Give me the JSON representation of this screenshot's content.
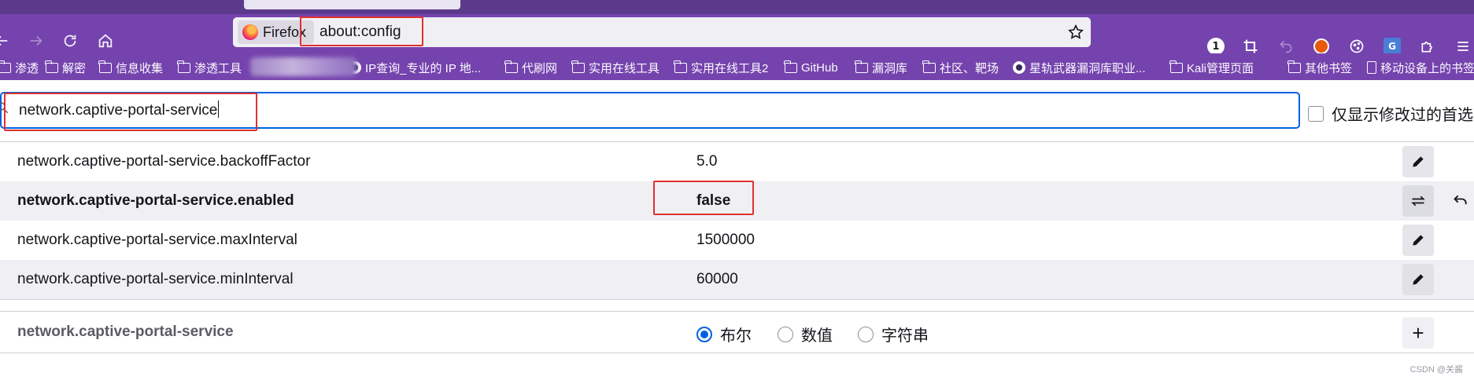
{
  "browser": {
    "identity_label": "Firefox",
    "url": "about:config",
    "extension_badge": "1"
  },
  "bookmarks": [
    {
      "label": "渗透",
      "icon": "folder-icon"
    },
    {
      "label": "解密",
      "icon": "folder-icon"
    },
    {
      "label": "信息收集",
      "icon": "folder-icon"
    },
    {
      "label": "渗透工具",
      "icon": "folder-icon"
    },
    {
      "label": "IP查询_专业的 IP 地...",
      "icon": "globe-icon"
    },
    {
      "label": "代刷网",
      "icon": "folder-icon"
    },
    {
      "label": "实用在线工具",
      "icon": "folder-icon"
    },
    {
      "label": "实用在线工具2",
      "icon": "folder-icon"
    },
    {
      "label": "GitHub",
      "icon": "folder-icon"
    },
    {
      "label": "漏洞库",
      "icon": "folder-icon"
    },
    {
      "label": "社区、靶场",
      "icon": "folder-icon"
    },
    {
      "label": "星轨武器漏洞库职业...",
      "icon": "globe-icon"
    },
    {
      "label": "Kali管理页面",
      "icon": "folder-icon"
    },
    {
      "label": "其他书签",
      "icon": "folder-icon"
    },
    {
      "label": "移动设备上的书签",
      "icon": "mobile-icon"
    }
  ],
  "config": {
    "search_value": "network.captive-portal-service",
    "show_modified_label": "仅显示修改过的首选项",
    "prefs": [
      {
        "name": "network.captive-portal-service.backoffFactor",
        "value": "5.0",
        "modified": false,
        "action": "edit"
      },
      {
        "name": "network.captive-portal-service.enabled",
        "value": "false",
        "modified": true,
        "action": "toggle"
      },
      {
        "name": "network.captive-portal-service.maxInterval",
        "value": "1500000",
        "modified": false,
        "action": "edit"
      },
      {
        "name": "network.captive-portal-service.minInterval",
        "value": "60000",
        "modified": false,
        "action": "edit"
      }
    ],
    "new_pref": {
      "name": "network.captive-portal-service",
      "types": [
        "布尔",
        "数值",
        "字符串"
      ],
      "selected_type": "布尔",
      "add_label": "+"
    }
  },
  "watermark": "CSDN @关酱",
  "colors": {
    "chrome_purple": "#7543ad",
    "accent_blue": "#0061e0",
    "annotation_red": "#e03131"
  }
}
